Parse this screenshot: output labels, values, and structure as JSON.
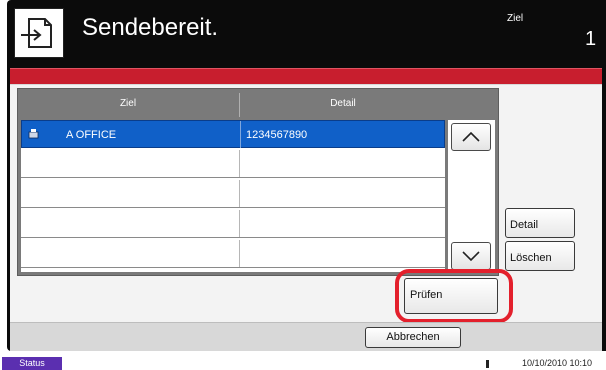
{
  "header": {
    "title": "Sendebereit.",
    "destination_label": "Ziel",
    "destination_count": "1"
  },
  "table": {
    "columns": [
      "Ziel",
      "Detail"
    ],
    "rows": [
      {
        "name": "A OFFICE",
        "detail": "1234567890",
        "selected": true,
        "icon": "fax-machine-icon"
      },
      {
        "name": "",
        "detail": "",
        "selected": false
      },
      {
        "name": "",
        "detail": "",
        "selected": false
      },
      {
        "name": "",
        "detail": "",
        "selected": false
      },
      {
        "name": "",
        "detail": "",
        "selected": false
      }
    ]
  },
  "buttons": {
    "detail": "Detail",
    "delete": "Löschen",
    "check": "Prüfen",
    "cancel": "Abbrechen"
  },
  "status_bar": {
    "status_label": "Status",
    "datetime": "10/10/2010 10:10"
  },
  "colors": {
    "title_bar": "#0b0b0b",
    "alert_bar": "#c81e2e",
    "selected_row": "#1060c8",
    "highlight_ring": "#e3202c",
    "status_button": "#5b2fb0"
  }
}
